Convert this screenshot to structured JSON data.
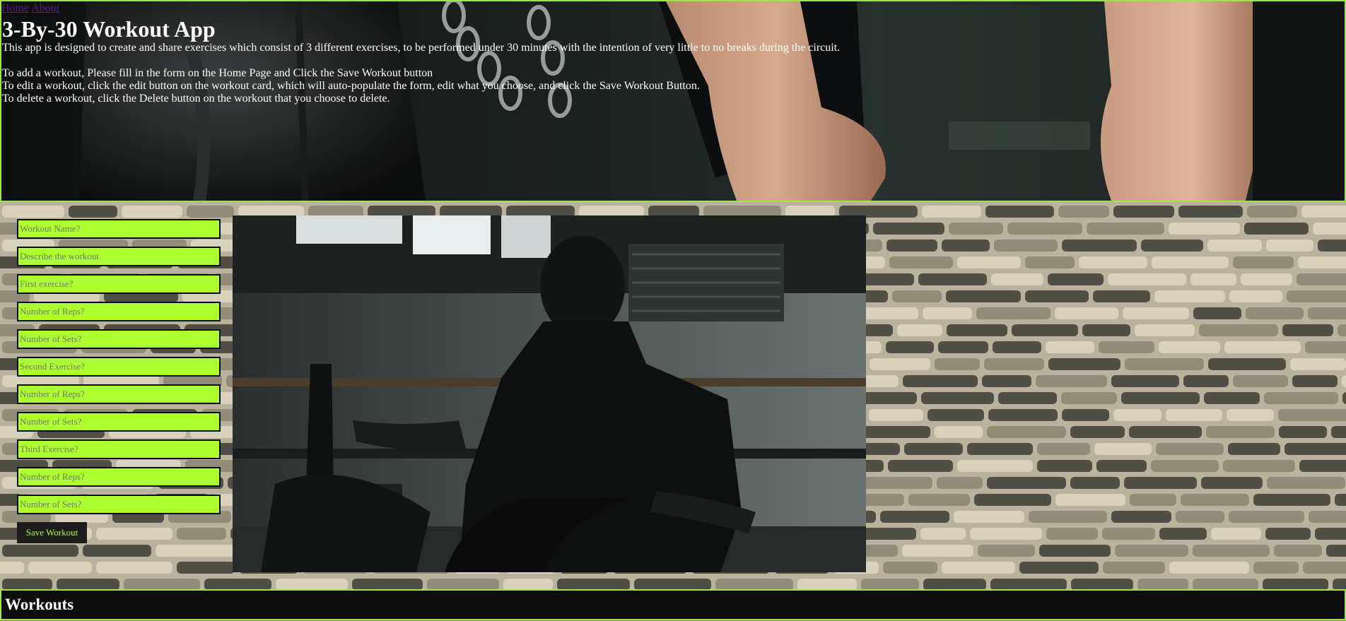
{
  "nav": {
    "home_label": "Home",
    "about_label": "About"
  },
  "hero": {
    "title": "3-By-30 Workout App",
    "description": "This app is designed to create and share exercises which consist of 3 different exercises, to be performed under 30 minutes with the intention of very little to no breaks during the circuit.",
    "instructions": [
      "To add a workout, Please fill in the form on the Home Page and Click the Save Workout button",
      "To edit a workout, click the edit button on the workout card, which will auto-populate the form, edit what you choose, and click the Save Workout Button.",
      "To delete a workout, click the Delete button on the workout that you choose to delete."
    ]
  },
  "form": {
    "workout_name_placeholder": "Workout Name?",
    "description_placeholder": "Describe the workout",
    "exercise1_placeholder": "First exercise?",
    "exercise1_reps_placeholder": "Number of Reps?",
    "exercise1_sets_placeholder": "Number of Sets?",
    "exercise2_placeholder": "Second Exercise?",
    "exercise2_reps_placeholder": "Number of Reps?",
    "exercise2_sets_placeholder": "Number of Sets?",
    "exercise3_placeholder": "Third Exercise?",
    "exercise3_reps_placeholder": "Number of Reps?",
    "exercise3_sets_placeholder": "Number of Sets?",
    "save_label": "Save Workout"
  },
  "workouts": {
    "heading": "Workouts"
  },
  "colors": {
    "accent": "#adff2f",
    "border": "#9ee34f",
    "dark": "#0d0d0d",
    "link": "#551a8b"
  }
}
